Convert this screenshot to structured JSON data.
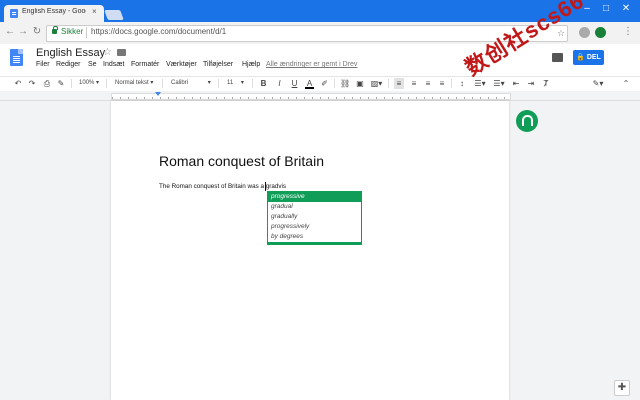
{
  "browser": {
    "tab_title": "English Essay - Google D",
    "tab_close": "×",
    "win_minimize": "–",
    "win_maximize": "□",
    "win_close": "✕",
    "secure_label": "Sikker",
    "url": "https://docs.google.com/document/d/1"
  },
  "doc": {
    "title": "English Essay",
    "menu": [
      "Filer",
      "Rediger",
      "Se",
      "Indsæt",
      "Formatér",
      "Værktøjer",
      "Tilføjelser",
      "Hjælp"
    ],
    "saved_status": "Alle ændringer er gemt i Drev",
    "share_label": "DEL"
  },
  "toolbar": {
    "zoom": "100%",
    "style": "Normal tekst",
    "font": "Calibri",
    "size": "11",
    "bold": "B",
    "italic": "I",
    "underline": "U",
    "text_color": "A"
  },
  "content": {
    "heading": "Roman conquest of Britain",
    "body_line": "The Roman conquest of Britain was a gradvis"
  },
  "suggestions": {
    "items": [
      "progressive",
      "gradual",
      "gradually",
      "progressively",
      "by degrees"
    ],
    "selected_index": 0
  },
  "watermark": "数创社scs66",
  "colors": {
    "chrome_blue": "#1b73e8",
    "share_blue": "#1a73e8",
    "accent_green": "#0f9d58",
    "watermark_red": "#c01818"
  }
}
